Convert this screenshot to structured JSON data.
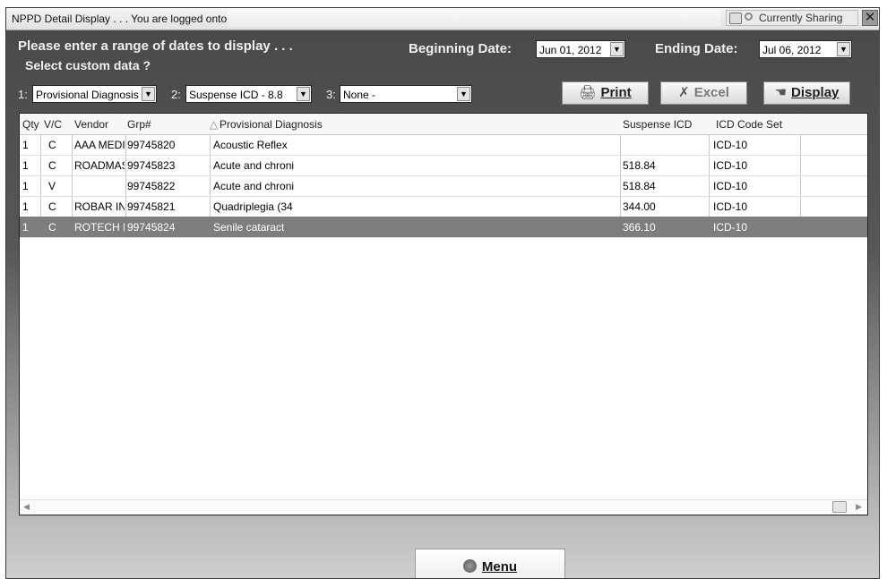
{
  "window": {
    "title": "NPPD Detail Display . . . You are logged onto",
    "sharing_label": "Currently Sharing",
    "close_glyph": "✕"
  },
  "form": {
    "prompt": "Please enter a range of dates to display . . .",
    "custom_label": "Select custom data ?",
    "beginning_label": "Beginning Date:",
    "beginning_value": "Jun 01, 2012",
    "ending_label": "Ending Date:",
    "ending_value": "Jul 06, 2012",
    "slot1_label": "1:",
    "slot1_value": "Provisional Diagnosis",
    "slot2_label": "2:",
    "slot2_value": "Suspense ICD - 8.8",
    "slot3_label": "3:",
    "slot3_value": "None -"
  },
  "toolbar": {
    "print_label": "Print",
    "excel_label": "Excel",
    "display_label": "Display",
    "print_icon": "printer-icon",
    "excel_icon": "excel-icon",
    "display_icon": "hand-icon"
  },
  "table": {
    "columns": [
      "Qty",
      "V/C",
      "Vendor",
      "Grp#",
      "Provisional Diagnosis",
      "Suspense ICD",
      "ICD Code Set"
    ],
    "sort_indicator": "△",
    "rows": [
      {
        "qty": "1",
        "vc": "C",
        "vendor": "AAA MEDI",
        "grp": "99745820",
        "diag": "Acoustic Reflex",
        "icd": "",
        "codeset": "ICD-10"
      },
      {
        "qty": "1",
        "vc": "C",
        "vendor": "ROADMAS",
        "grp": "99745823",
        "diag": "Acute and chroni",
        "icd": "518.84",
        "codeset": "ICD-10"
      },
      {
        "qty": "1",
        "vc": "V",
        "vendor": "",
        "grp": "99745822",
        "diag": "Acute and chroni",
        "icd": "518.84",
        "codeset": "ICD-10"
      },
      {
        "qty": "1",
        "vc": "C",
        "vendor": "ROBAR IN",
        "grp": "99745821",
        "diag": "Quadriplegia (34",
        "icd": "344.00",
        "codeset": "ICD-10"
      },
      {
        "qty": "1",
        "vc": "C",
        "vendor": "ROTECH H",
        "grp": "99745824",
        "diag": "Senile cataract",
        "icd": "366.10",
        "codeset": "ICD-10"
      }
    ],
    "selected_row": 4
  },
  "footer": {
    "menu_label": "Menu",
    "menu_icon": "globe-icon"
  },
  "colors": {
    "panel": "#555555",
    "selected_row": "#7e7e7e"
  }
}
